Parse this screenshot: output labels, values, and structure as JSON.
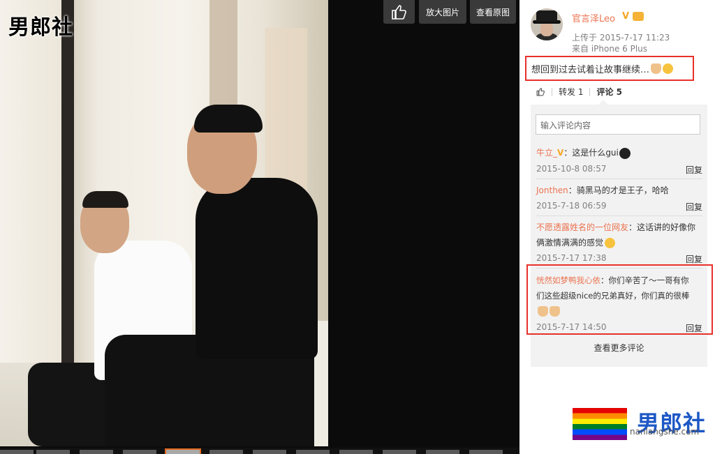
{
  "photo_watermark": "男郎社",
  "toolbar": {
    "like_icon": "thumbs-up-icon",
    "zoom_label": "放大图片",
    "original_label": "查看原图"
  },
  "post": {
    "username": "官言泽Leo",
    "verified": "V",
    "upload_time": "上传于 2015-7-17 11:23",
    "device": "来自 iPhone 6 Plus",
    "text": "想回到过去试着让故事继续…",
    "repost_label": "转发 1",
    "comment_label": "评论 5"
  },
  "comment_input": {
    "placeholder": "输入评论内容"
  },
  "comments": [
    {
      "name": "牛立_",
      "badge": "V",
      "text": "：这是什么gui",
      "time": "2015-10-8 08:57",
      "reply": "回复"
    },
    {
      "name": "Jonthen",
      "text": "：骑黑马的才是王子，哈哈",
      "time": "2015-7-18 06:59",
      "reply": "回复"
    },
    {
      "name": "不愿透露姓名的一位网友",
      "text": "：这话讲的好像你",
      "text2": "俩激情满满的感觉",
      "time": "2015-7-17 17:38",
      "reply": "回复"
    },
    {
      "name": "恍然如梦鸭我心依",
      "text": "：你们辛苦了～一哥有你",
      "text2": "们这些超级nice的兄弟真好，你们真的很棒",
      "time": "2015-7-17 14:50",
      "reply": "回复"
    }
  ],
  "more_comments": "查看更多评论",
  "logo": {
    "text": "男郎社",
    "url": "nanlangshe.com"
  },
  "colors": {
    "accent": "#eb7350",
    "highlight_border": "#e8302b",
    "logo_blue": "#1c57c6"
  }
}
